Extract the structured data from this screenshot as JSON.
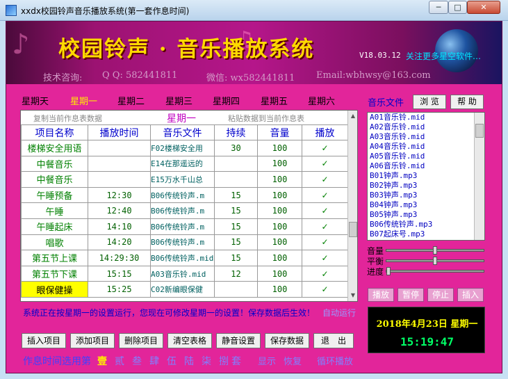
{
  "window": {
    "title": "xxdx校园铃声音乐播放系统(第一套作息时间)",
    "min_symbol": "─",
    "max_symbol": "□",
    "close_symbol": "✕"
  },
  "banner": {
    "title": "校园铃声 · 音乐播放系统",
    "version": "V18.03.12",
    "follow": "关注更多星空软件…",
    "contact_tech": "技术咨询:",
    "contact_qq": "Q Q: 582441811",
    "contact_wechat": "微信: wx582441811",
    "contact_email": "Email:wbhwsy@163.com"
  },
  "days": [
    "星期天",
    "星期一",
    "星期二",
    "星期三",
    "星期四",
    "星期五",
    "星期六"
  ],
  "active_day_index": 1,
  "schedule": {
    "copy_from": "复制当前作息表数据",
    "day_label": "星期一",
    "paste_to": "粘贴数据到当前作息表",
    "headers": [
      "项目名称",
      "播放时间",
      "音乐文件",
      "持续",
      "音量",
      "播放"
    ],
    "rows": [
      [
        "楼梯安全用语",
        "",
        "F02楼梯安全用",
        "30",
        "100",
        "✓"
      ],
      [
        "中餐音乐",
        "",
        "E14在那遥远的",
        "",
        "100",
        "✓"
      ],
      [
        "中餐音乐",
        "",
        "E15万水千山总",
        "",
        "100",
        "✓"
      ],
      [
        "午睡预备",
        "12:30",
        "B06传统铃声.m",
        "15",
        "100",
        "✓"
      ],
      [
        "午睡",
        "12:40",
        "B06传统铃声.m",
        "15",
        "100",
        "✓"
      ],
      [
        "午睡起床",
        "14:10",
        "B06传统铃声.m",
        "15",
        "100",
        "✓"
      ],
      [
        "唱歌",
        "14:20",
        "B06传统铃声.m",
        "15",
        "100",
        "✓"
      ],
      [
        "第五节上课",
        "14:29:30",
        "B06传统铃声.mid",
        "15",
        "100",
        "✓"
      ],
      [
        "第五节下课",
        "15:15",
        "A03音乐铃.mid",
        "12",
        "100",
        "✓"
      ],
      [
        "眼保健操",
        "15:25",
        "C02新编眼保健",
        "",
        "100",
        "✓"
      ]
    ],
    "highlight_row": 9
  },
  "status": {
    "message": "系统正在按星期一的设置运行，您现在可修改星期一的设置！保存数据后生效！",
    "link": "自动运行"
  },
  "buttons": [
    "插入项目",
    "添加项目",
    "删除项目",
    "清空表格",
    "静音设置",
    "保存数据",
    "退　出"
  ],
  "sets": {
    "label": "作息时间选用第",
    "items": [
      "壹",
      "贰",
      "叁",
      "肆",
      "伍",
      "陆",
      "柒",
      "捌",
      "套"
    ],
    "active_index": 0,
    "link1": "显示",
    "link2": "恢复",
    "link3": "循环播放"
  },
  "music": {
    "title": "音乐文件",
    "browse": "浏 览",
    "help": "帮 助",
    "files": [
      "A01音乐铃.mid",
      "A02音乐铃.mid",
      "A03音乐铃.mid",
      "A04音乐铃.mid",
      "A05音乐铃.mid",
      "A06音乐铃.mid",
      "B01钟声.mp3",
      "B02钟声.mp3",
      "B03钟声.mp3",
      "B04钟声.mp3",
      "B05钟声.mp3",
      "B06传统铃声.mp3",
      "B07起床号.mp3"
    ]
  },
  "sliders": {
    "volume_label": "音量",
    "balance_label": "平衡",
    "progress_label": "进度",
    "volume": 0.5,
    "balance": 0.5,
    "progress": 0
  },
  "play_controls": [
    "播放",
    "暂停",
    "停止",
    "插入"
  ],
  "clock": {
    "date": "2018年4月23日  星期一",
    "time": "15:19:47"
  }
}
